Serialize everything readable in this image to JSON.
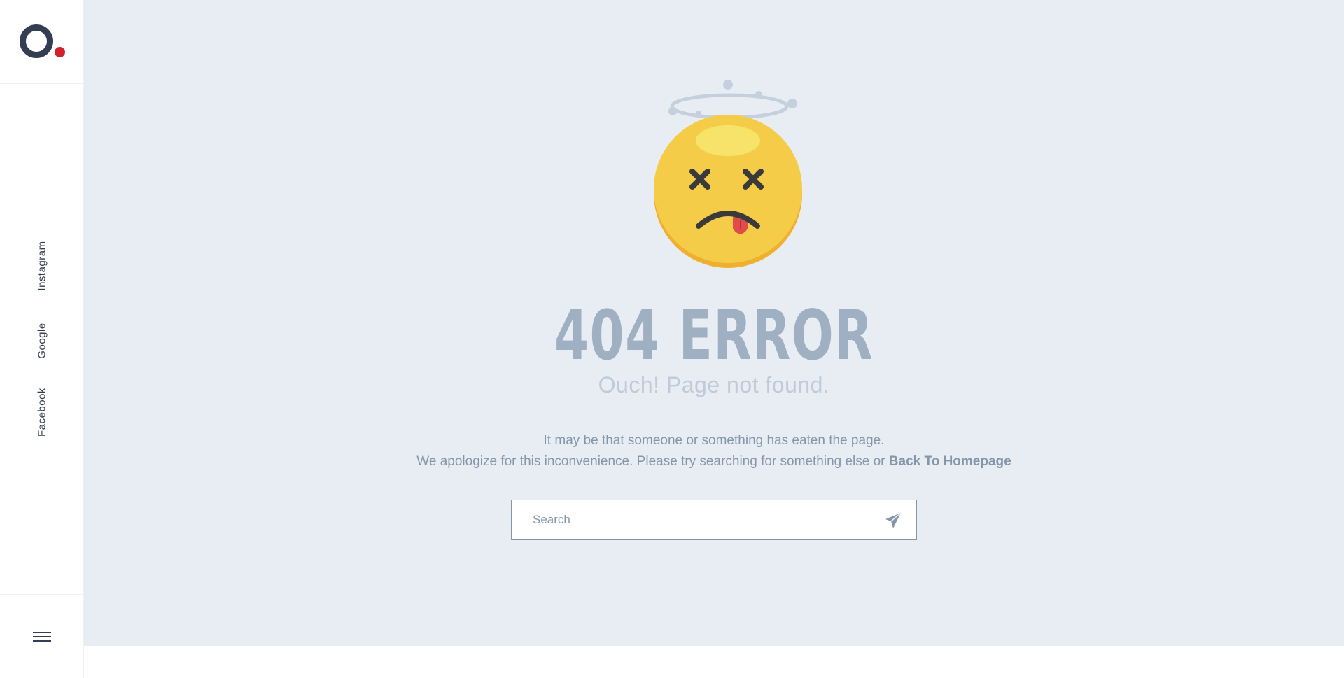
{
  "sidebar": {
    "social_links": [
      "Instagram",
      "Google",
      "Facebook"
    ]
  },
  "error": {
    "title": "404 ERROR",
    "subtitle": "Ouch! Page not found.",
    "message_line1": "It may be that someone or something has eaten the page.",
    "message_line2": "We apologize for this inconvenience. Please try searching for something else or",
    "home_link": "Back To Homepage"
  },
  "search": {
    "placeholder": "Search",
    "value": ""
  },
  "icons": {
    "logo": "logo-icon",
    "menu": "hamburger-menu-icon",
    "search_submit": "paper-plane-icon",
    "illustration": "dizzy-face-emoji-icon"
  },
  "colors": {
    "background": "#e8edf3",
    "sidebar": "#ffffff",
    "logo_dark": "#343e52",
    "logo_accent": "#d0232b",
    "title": "#9eb0c2",
    "subtitle": "#bfcbd8",
    "text": "#8596aa",
    "emoji_face": "#f5cc48"
  }
}
